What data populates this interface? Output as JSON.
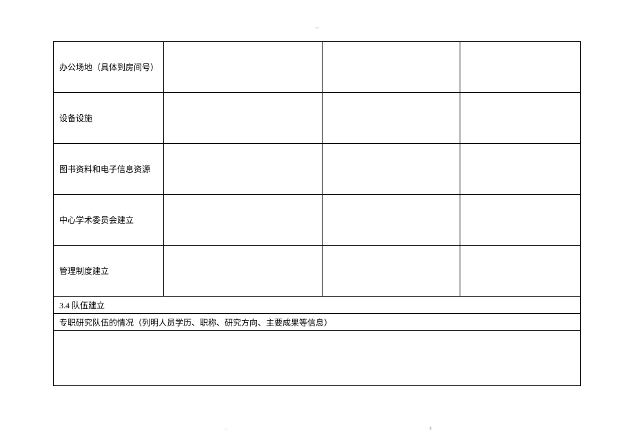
{
  "topMark": "--",
  "rows": {
    "row1": {
      "label": "办公场地（具体到房间号）",
      "c2": "",
      "c3": "",
      "c4": ""
    },
    "row2": {
      "label": "设备设施",
      "c2": "",
      "c3": "",
      "c4": ""
    },
    "row3": {
      "label": "图书资料和电子信息资源",
      "c2": "",
      "c3": "",
      "c4": ""
    },
    "row4": {
      "label": "中心学术委员会建立",
      "c2": "",
      "c3": "",
      "c4": ""
    },
    "row5": {
      "label": "管理制度建立",
      "c2": "",
      "c3": "",
      "c4": ""
    }
  },
  "section": "3.4 队伍建立",
  "subtitle": "专职研究队伍的情况（列明人员学历、职称、研究方向、主要成果等信息）",
  "content": "",
  "bottomMarkLeft": ".",
  "bottomMarkRight": "z"
}
